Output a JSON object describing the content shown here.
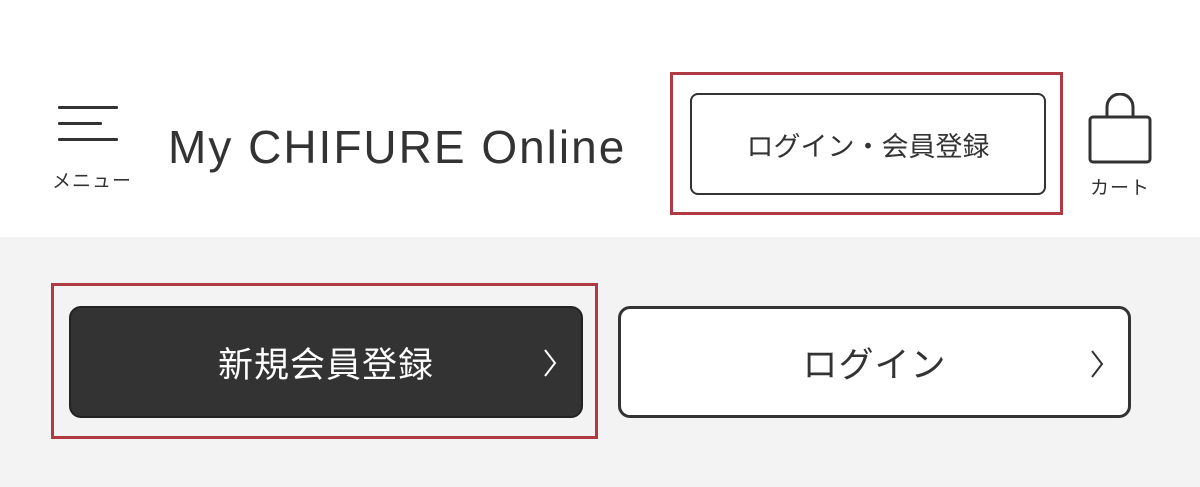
{
  "header": {
    "menu_label": "メニュー",
    "site_title": "My CHIFURE Online",
    "login_register_label": "ログイン・会員登録",
    "cart_label": "カート"
  },
  "actions": {
    "register_label": "新規会員登録",
    "login_label": "ログイン"
  },
  "icons": {
    "menu": "hamburger-menu-icon",
    "cart": "shopping-bag-icon",
    "chevron": "chevron-right-icon"
  },
  "colors": {
    "text": "#333333",
    "primary_button_bg": "#333333",
    "primary_button_text": "#ffffff",
    "section_bg": "#f3f3f3",
    "highlight_border": "#b03a44"
  }
}
